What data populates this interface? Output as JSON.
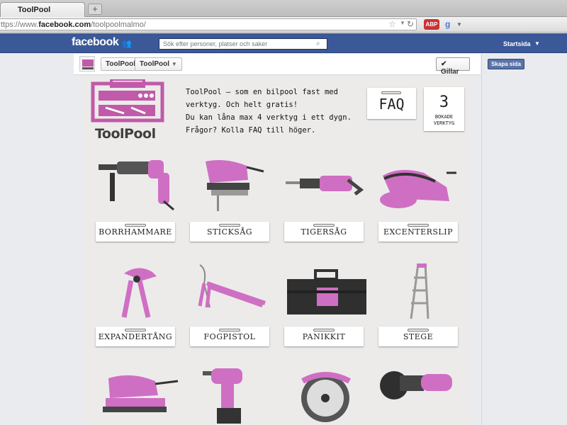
{
  "browser": {
    "tab_title": "ToolPool",
    "new_tab_symbol": "+",
    "url_prefix": "ttps://www.",
    "url_domain": "facebook.com",
    "url_path": "/toolpoolmalmo/"
  },
  "facebook": {
    "logo": "facebook",
    "search_placeholder": "Sök efter personer, platser och saker",
    "home_label": "Startsida"
  },
  "page_header": {
    "name_button": "ToolPool",
    "dropdown_button": "ToolPool",
    "like_button": "Gillar",
    "create_page_button": "Skapa sida"
  },
  "app": {
    "logo_text": "ToolPool",
    "intro_lines": [
      "ToolPool – som en bilpool fast med",
      "verktyg. Och helt gratis!",
      "Du kan låna max 4 verktyg i ett dygn.",
      "Frågor? Kolla FAQ till höger."
    ],
    "faq_label": "FAQ",
    "booked_count": "3",
    "booked_label_1": "BOKADE",
    "booked_label_2": "VERKTYG",
    "tools": [
      {
        "label": "BORRHAMMARE",
        "icon": "rotary-hammer-icon"
      },
      {
        "label": "STICKSÅG",
        "icon": "jigsaw-icon"
      },
      {
        "label": "TIGERSÅG",
        "icon": "reciprocating-saw-icon"
      },
      {
        "label": "EXCENTERSLIP",
        "icon": "orbital-sander-icon"
      },
      {
        "label": "EXPANDERTÅNG",
        "icon": "expander-pliers-icon"
      },
      {
        "label": "FOGPISTOL",
        "icon": "caulk-gun-icon"
      },
      {
        "label": "PANIKKIT",
        "icon": "toolbox-icon"
      },
      {
        "label": "STEGE",
        "icon": "ladder-icon"
      },
      {
        "label": "",
        "icon": "detail-sander-icon"
      },
      {
        "label": "",
        "icon": "cordless-drill-icon"
      },
      {
        "label": "",
        "icon": "circular-saw-icon"
      },
      {
        "label": "",
        "icon": "angle-grinder-icon"
      }
    ]
  },
  "colors": {
    "fb_blue": "#3b5998",
    "tool_pink": "#cf6fc3",
    "logo_pink": "#c05aa9"
  }
}
